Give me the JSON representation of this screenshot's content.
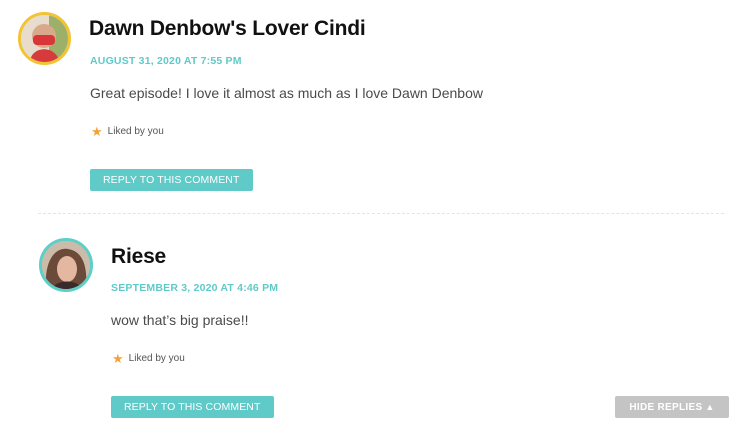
{
  "comments": [
    {
      "author": "Dawn Denbow's Lover Cindi",
      "date": "AUGUST 31, 2020 AT 7:55 PM",
      "text": "Great episode! I love it almost as much as I love Dawn Denbow",
      "liked_label": "Liked by you",
      "reply_label": "REPLY TO THIS COMMENT"
    },
    {
      "author": "Riese",
      "date": "SEPTEMBER 3, 2020 AT 4:46 PM",
      "text": "wow that’s big praise!!",
      "liked_label": "Liked by you",
      "reply_label": "REPLY TO THIS COMMENT"
    }
  ],
  "hide_replies": {
    "label": "HIDE REPLIES",
    "arrow": "▲"
  },
  "icons": {
    "star": "star-icon",
    "arrow": "triangle-up-icon"
  },
  "colors": {
    "accent": "#5fcac8",
    "author": "#111111",
    "star": "#f3a23a",
    "avatar1_border": "#f2c335",
    "avatar2_border": "#5ccfc9",
    "hide_button": "#c4c4c4"
  }
}
